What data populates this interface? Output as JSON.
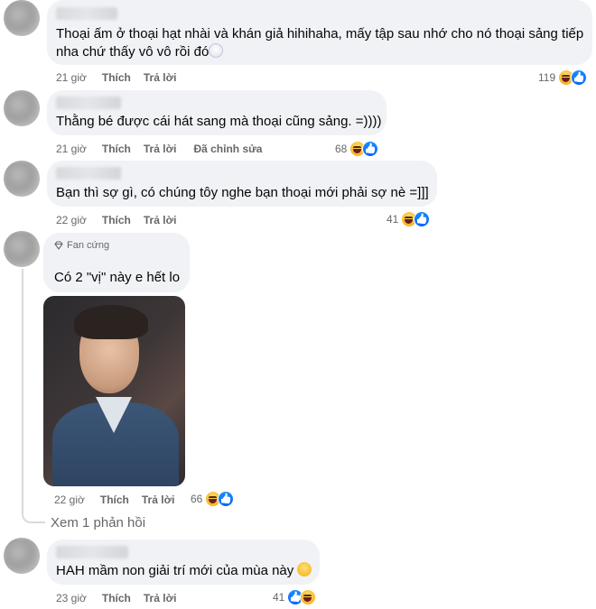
{
  "comments": [
    {
      "text_line1": "Thoại ấm ở thoại hạt nhài và khán giả hihihaha, mấy tập sau nhớ cho nó thoại sảng tiếp",
      "text_line2": "nha chứ thấy vô vô rồi đó",
      "emoji_name": "clown-face-icon",
      "time": "21 giờ",
      "like_label": "Thích",
      "reply_label": "Trả lời",
      "reaction_count": "119",
      "reactions": [
        "haha",
        "like"
      ]
    },
    {
      "text_line1": "Thằng bé được cái hát sang mà thoại cũng sảng. =))))",
      "time": "21 giờ",
      "like_label": "Thích",
      "reply_label": "Trả lời",
      "edited_label": "Đã chỉnh sửa",
      "reaction_count": "68",
      "reactions": [
        "haha",
        "like"
      ]
    },
    {
      "text_line1": "Bạn thì sợ gì, có chúng tôy nghe bạn thoại mới phải sợ nè =]]]",
      "time": "22 giờ",
      "like_label": "Thích",
      "reply_label": "Trả lời",
      "reaction_count": "41",
      "reactions": [
        "haha",
        "like"
      ]
    },
    {
      "badge": "Fan cứng",
      "text_line1": "Có 2 \"vị\" này e hết lo",
      "time": "22 giờ",
      "like_label": "Thích",
      "reply_label": "Trả lời",
      "reaction_count": "66",
      "reactions": [
        "haha",
        "like"
      ]
    },
    {
      "text_line1": "HAH mầm non giải trí mới của mùa này",
      "emoji_name": "smile-face-icon",
      "time": "23 giờ",
      "like_label": "Thích",
      "reply_label": "Trả lời",
      "reaction_count": "41",
      "reactions": [
        "like",
        "haha"
      ]
    }
  ],
  "see_replies_label": "Xem 1 phản hồi",
  "colors": {
    "bubble": "#f0f2f5",
    "meta_text": "#65676b",
    "like_blue": "#0866ff",
    "haha_yellow": "#f7b928"
  }
}
